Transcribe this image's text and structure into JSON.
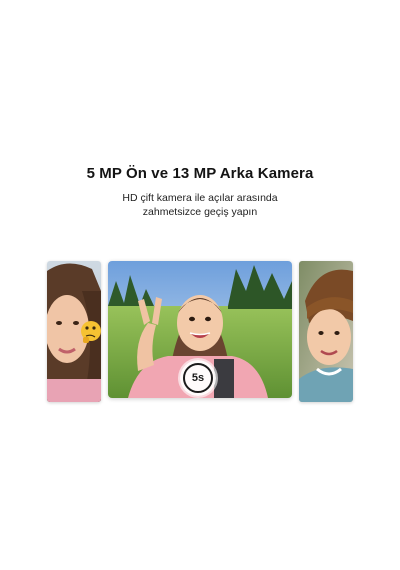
{
  "header": {
    "title": "5 MP Ön ve 13 MP Arka Kamera",
    "subtitle_line1": "HD çift kamera ile açılar arasında",
    "subtitle_line2": "zahmetsizce geçiş yapın"
  },
  "gallery": {
    "cards": [
      {
        "name": "left-selfie-photo",
        "icon": "emoji-thinking-face"
      },
      {
        "name": "center-peace-sign-photo"
      },
      {
        "name": "right-boy-photo"
      }
    ],
    "timer_label": "5s"
  },
  "colors": {
    "title": "#141414",
    "sky": "#8fb8e8",
    "grass": "#7fb24a",
    "shirt": "#f1a6b2"
  }
}
